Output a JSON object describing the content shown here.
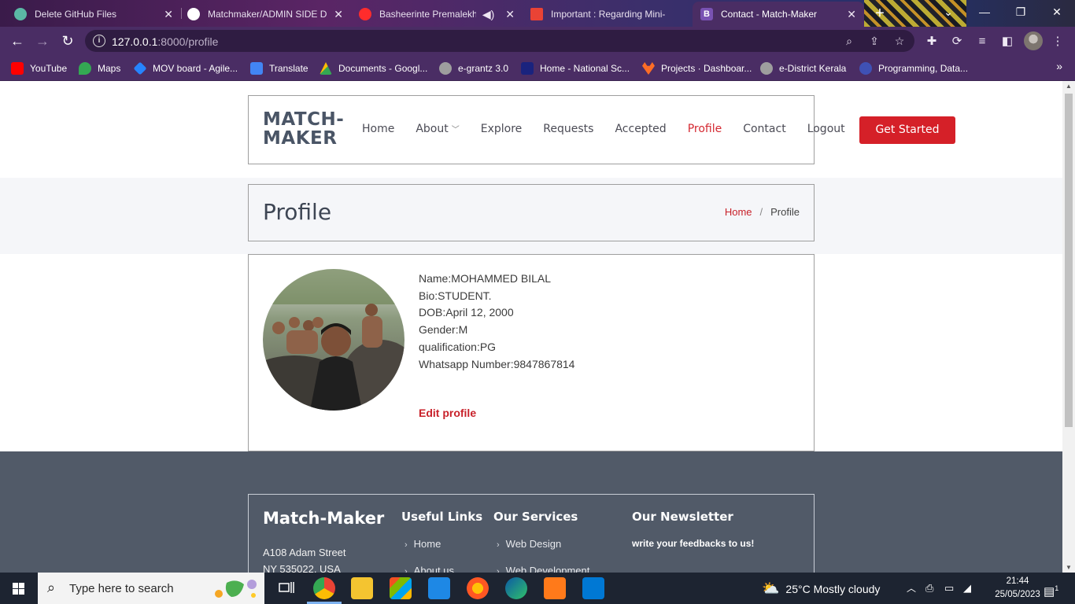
{
  "browser": {
    "tabs": [
      {
        "label": "Delete GitHub Files",
        "favicon_color": "#5bb8a5"
      },
      {
        "label": "Matchmaker/ADMIN SIDE D",
        "favicon_color": "#ffffff"
      },
      {
        "label": "Basheerinte Premalekha",
        "favicon_color": "#ff2c2c"
      },
      {
        "label": "Important : Regarding Mini-",
        "favicon_color": "#ea4335"
      },
      {
        "label": "Contact - Match-Maker",
        "favicon_color": "#7952b3"
      }
    ],
    "active_tab": "Contact - Match-Maker",
    "url_host": "127.0.0.1",
    "url_rest": ":8000/profile",
    "bookmarks": [
      {
        "label": "YouTube",
        "color": "#ff0000"
      },
      {
        "label": "Maps",
        "color": "#34a853"
      },
      {
        "label": "MOV board - Agile...",
        "color": "#2684ff"
      },
      {
        "label": "Translate",
        "color": "#4285f4"
      },
      {
        "label": "Documents - Googl...",
        "color": "#fbbc04"
      },
      {
        "label": "e-grantz 3.0",
        "color": "#9e9e9e"
      },
      {
        "label": "Home - National Sc...",
        "color": "#1a237e"
      },
      {
        "label": "Projects · Dashboar...",
        "color": "#fc6d26"
      },
      {
        "label": "e-District Kerala",
        "color": "#9e9e9e"
      },
      {
        "label": "Programming, Data...",
        "color": "#3f51b5"
      }
    ]
  },
  "site": {
    "logo_line1": "MATCH-",
    "logo_line2": "MAKER",
    "nav": [
      "Home",
      "About",
      "Explore",
      "Requests",
      "Accepted",
      "Profile",
      "Contact",
      "Logout"
    ],
    "active_nav": "Profile",
    "cta": "Get Started",
    "accent": "#d52028"
  },
  "breadcrumb": {
    "title": "Profile",
    "home": "Home",
    "sep": "/",
    "current": "Profile"
  },
  "profile": {
    "name": "Name:MOHAMMED BILAL",
    "bio": "Bio:STUDENT.",
    "dob": "DOB:April 12, 2000",
    "gender": "Gender:M",
    "qualification": "qualification:PG",
    "whatsapp": "Whatsapp Number:9847867814",
    "edit": "Edit profile"
  },
  "footer": {
    "brand": "Match-Maker",
    "address_1": "A108 Adam Street",
    "address_2": "NY 535022, USA",
    "useful_links_title": "Useful Links",
    "useful_links": [
      "Home",
      "About us"
    ],
    "services_title": "Our Services",
    "services": [
      "Web Design",
      "Web Development"
    ],
    "newsletter_title": "Our Newsletter",
    "newsletter_text": "write your feedbacks to us!"
  },
  "taskbar": {
    "search_placeholder": "Type here to search",
    "weather": "25°C  Mostly cloudy",
    "time": "21:44",
    "date": "25/05/2023",
    "notifications": "1"
  }
}
